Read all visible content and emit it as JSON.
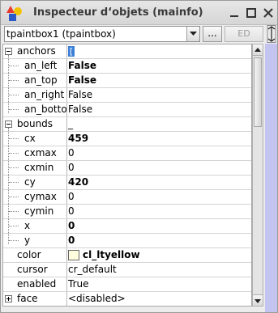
{
  "window": {
    "title": "Inspecteur d‘objets (mainfo)",
    "controls": [
      "minimize-icon",
      "maximize-icon",
      "close-icon"
    ]
  },
  "toolbar": {
    "component_value": "tpaintbox1 (tpaintbox)",
    "dots_label": "...",
    "ed_label": "ED"
  },
  "properties": [
    {
      "name": "anchors",
      "value": "[",
      "level": 0,
      "expander": "minus",
      "selected": true
    },
    {
      "name": "an_left",
      "value": "False",
      "level": 1,
      "bold": true
    },
    {
      "name": "an_top",
      "value": "False",
      "level": 1,
      "bold": true
    },
    {
      "name": "an_right",
      "value": "False",
      "level": 1
    },
    {
      "name": "an_bottom",
      "value": "False",
      "level": 1
    },
    {
      "name": "bounds",
      "value": "_",
      "level": 0,
      "expander": "minus"
    },
    {
      "name": "cx",
      "value": "459",
      "level": 1,
      "bold": true
    },
    {
      "name": "cxmax",
      "value": "0",
      "level": 1
    },
    {
      "name": "cxmin",
      "value": "0",
      "level": 1
    },
    {
      "name": "cy",
      "value": "420",
      "level": 1,
      "bold": true
    },
    {
      "name": "cymax",
      "value": "0",
      "level": 1
    },
    {
      "name": "cymin",
      "value": "0",
      "level": 1
    },
    {
      "name": "x",
      "value": "0",
      "level": 1,
      "bold": true
    },
    {
      "name": "y",
      "value": "0",
      "level": 1,
      "bold": true
    },
    {
      "name": "color",
      "value": "cl_ltyellow",
      "level": 0,
      "bold": true,
      "swatch": "#ffffe0"
    },
    {
      "name": "cursor",
      "value": "cr_default",
      "level": 0
    },
    {
      "name": "enabled",
      "value": "True",
      "level": 0
    },
    {
      "name": "face",
      "value": "<disabled>",
      "level": 0,
      "expander": "plus"
    }
  ],
  "colors": {
    "selection": "#3b7fd6",
    "side_panel": "#c4c4f0",
    "swatch_ltyellow": "#ffffe0"
  }
}
